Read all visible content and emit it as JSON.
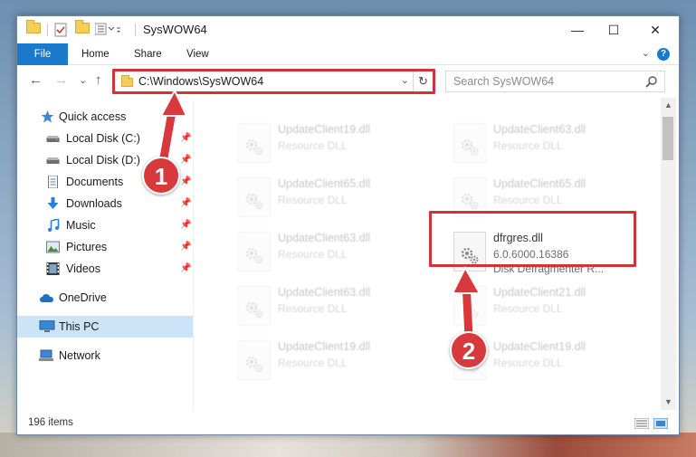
{
  "window": {
    "title": "SysWOW64",
    "minimize_glyph": "—",
    "maximize_glyph": "☐",
    "close_glyph": "✕"
  },
  "ribbon": {
    "tabs": [
      {
        "label": "File",
        "active": true
      },
      {
        "label": "Home"
      },
      {
        "label": "Share"
      },
      {
        "label": "View"
      }
    ],
    "help_glyph": "?",
    "expand_glyph": "⌄"
  },
  "navigation": {
    "back_glyph": "←",
    "forward_glyph": "→",
    "recent_glyph": "⌄",
    "up_glyph": "↑",
    "address": "C:\\Windows\\SysWOW64",
    "address_dropdown_glyph": "⌄",
    "refresh_glyph": "↻",
    "search_placeholder": "Search SysWOW64"
  },
  "sidebar": {
    "items": [
      {
        "label": "Quick access",
        "icon": "star-icon",
        "pinned": false
      },
      {
        "label": "Local Disk (C:)",
        "icon": "drive-icon",
        "pinned": true
      },
      {
        "label": "Local Disk (D:)",
        "icon": "drive-icon",
        "pinned": true
      },
      {
        "label": "Documents",
        "icon": "documents-icon",
        "pinned": true
      },
      {
        "label": "Downloads",
        "icon": "download-icon",
        "pinned": true
      },
      {
        "label": "Music",
        "icon": "music-icon",
        "pinned": true
      },
      {
        "label": "Pictures",
        "icon": "pictures-icon",
        "pinned": true
      },
      {
        "label": "Videos",
        "icon": "videos-icon",
        "pinned": true
      },
      {
        "label": "OneDrive",
        "icon": "cloud-icon",
        "pinned": false
      },
      {
        "label": "This PC",
        "icon": "computer-icon",
        "pinned": false,
        "selected": true
      },
      {
        "label": "Network",
        "icon": "network-icon",
        "pinned": false
      }
    ],
    "pin_glyph": "📌"
  },
  "files": [
    {
      "name": "UpdateClient19.dll",
      "type": "Resource DLL",
      "faded": true
    },
    {
      "name": "UpdateClient63.dll",
      "type": "Resource DLL",
      "faded": true
    },
    {
      "name": "UpdateClient65.dll",
      "type": "Resource DLL",
      "faded": true
    },
    {
      "name": "UpdateClient65.dll",
      "type": "Resource DLL",
      "faded": true
    },
    {
      "name": "UpdateClient63.dll",
      "type": "Resource DLL",
      "faded": true
    },
    {
      "name": "dfrgres.dll",
      "version": "6.0.6000.16386",
      "description": "Disk Defragmenter R...",
      "faded": false,
      "highlighted": true
    },
    {
      "name": "UpdateClient63.dll",
      "type": "Resource DLL",
      "faded": true
    },
    {
      "name": "UpdateClient21.dll",
      "type": "Resource DLL",
      "faded": true
    },
    {
      "name": "UpdateClient19.dll",
      "type": "Resource DLL",
      "faded": true
    },
    {
      "name": "UpdateClient19.dll",
      "type": "Resource DLL",
      "faded": true
    }
  ],
  "scrollbar": {
    "up_glyph": "▲",
    "down_glyph": "▼"
  },
  "status": {
    "item_count": "196 items"
  },
  "callouts": [
    {
      "number": "1"
    },
    {
      "number": "2"
    }
  ],
  "colors": {
    "accent": "#1979ca",
    "highlight": "#d0343a",
    "callout": "#d8393c",
    "selected": "#cce4f7"
  }
}
